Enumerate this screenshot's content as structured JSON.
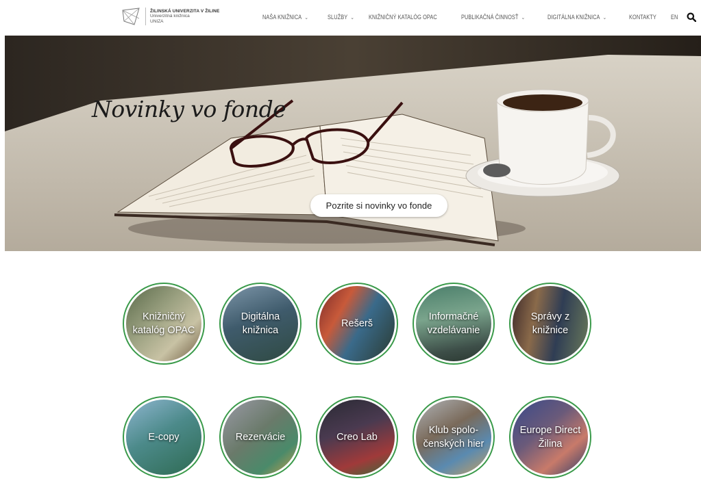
{
  "header": {
    "logo_line1": "ŽILINSKÁ UNIVERZITA V ŽILINE",
    "logo_line2": "Univerzitná knižnica",
    "logo_line3": "UNIZA",
    "nav": [
      {
        "label": "NAŠA KNIŽNICA",
        "dropdown": true
      },
      {
        "label": "SLUŽBY",
        "dropdown": true
      },
      {
        "label": "KNIŽNIČNÝ KATALÓG OPAC",
        "dropdown": false
      },
      {
        "label": "PUBLIKAČNÁ ČINNOSŤ",
        "dropdown": true
      },
      {
        "label": "DIGITÁLNA KNIŽNICA",
        "dropdown": true
      },
      {
        "label": "KONTAKTY",
        "dropdown": false
      }
    ],
    "lang": "EN",
    "search_icon": "search-icon"
  },
  "hero": {
    "title": "Novinky vo fonde",
    "button": "Pozrite si novinky vo fonde"
  },
  "tiles_row1": [
    {
      "label": "Knižničný katalóg OPAC"
    },
    {
      "label": "Digitálna knižnica"
    },
    {
      "label": "Rešerš"
    },
    {
      "label": "Informačné vzdelávanie"
    },
    {
      "label": "Správy z knižnice"
    }
  ],
  "tiles_row2": [
    {
      "label": "E-copy"
    },
    {
      "label": "Rezervácie"
    },
    {
      "label": "Creo Lab"
    },
    {
      "label": "Klub spolo-čenských hier"
    },
    {
      "label": "Europe Direct Žilina"
    }
  ],
  "colors": {
    "tile_border": "#3a9a4a",
    "nav_text": "#555555"
  }
}
